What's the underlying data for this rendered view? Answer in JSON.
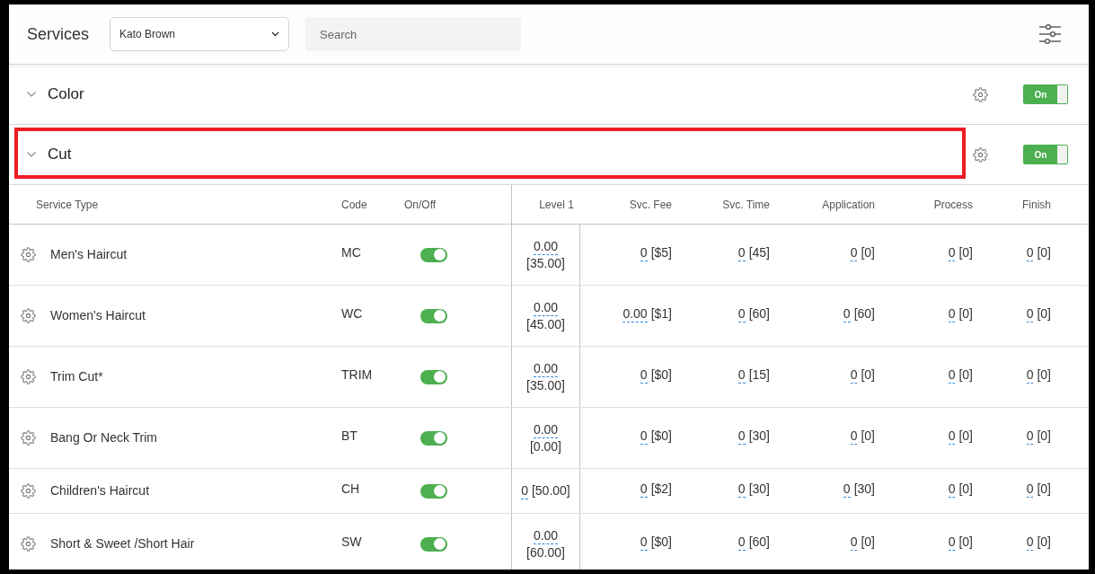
{
  "header": {
    "title": "Services",
    "staff_select": {
      "value": "Kato Brown"
    },
    "search": {
      "placeholder": "Search"
    }
  },
  "categories": [
    {
      "name": "Color",
      "highlighted": false,
      "toggle": {
        "label": "On",
        "on": true
      }
    },
    {
      "name": "Cut",
      "highlighted": true,
      "toggle": {
        "label": "On",
        "on": true
      },
      "table": {
        "columns": [
          {
            "label": "Service Type",
            "kind": "name"
          },
          {
            "label": "Code",
            "kind": "code"
          },
          {
            "label": "On/Off",
            "kind": "toggle"
          },
          {
            "label": "Level 1",
            "kind": "level"
          },
          {
            "label": "Svc. Fee",
            "kind": "amount"
          },
          {
            "label": "Svc. Time",
            "kind": "amount"
          },
          {
            "label": "Application",
            "kind": "amount"
          },
          {
            "label": "Process",
            "kind": "amount"
          },
          {
            "label": "Finish",
            "kind": "amount"
          }
        ],
        "rows": [
          {
            "cells": [
              {
                "text": "Men's Haircut"
              },
              {
                "text": "MC"
              },
              {
                "on": true
              },
              {
                "value": "0.00",
                "base": "[35.00]"
              },
              {
                "value": "0",
                "base": "[$5]"
              },
              {
                "value": "0",
                "base": "[45]"
              },
              {
                "value": "0",
                "base": "[0]"
              },
              {
                "value": "0",
                "base": "[0]"
              },
              {
                "value": "0",
                "base": "[0]"
              }
            ]
          },
          {
            "cells": [
              {
                "text": "Women's Haircut"
              },
              {
                "text": "WC"
              },
              {
                "on": true
              },
              {
                "value": "0.00",
                "base": "[45.00]"
              },
              {
                "value": "0.00",
                "base": "[$1]"
              },
              {
                "value": "0",
                "base": "[60]"
              },
              {
                "value": "0",
                "base": "[60]"
              },
              {
                "value": "0",
                "base": "[0]"
              },
              {
                "value": "0",
                "base": "[0]"
              }
            ]
          },
          {
            "cells": [
              {
                "text": "Trim Cut*"
              },
              {
                "text": "TRIM"
              },
              {
                "on": true
              },
              {
                "value": "0.00",
                "base": "[35.00]"
              },
              {
                "value": "0",
                "base": "[$0]"
              },
              {
                "value": "0",
                "base": "[15]"
              },
              {
                "value": "0",
                "base": "[0]"
              },
              {
                "value": "0",
                "base": "[0]"
              },
              {
                "value": "0",
                "base": "[0]"
              }
            ]
          },
          {
            "cells": [
              {
                "text": "Bang Or Neck Trim"
              },
              {
                "text": "BT"
              },
              {
                "on": true
              },
              {
                "value": "0.00",
                "base": "[0.00]"
              },
              {
                "value": "0",
                "base": "[$0]"
              },
              {
                "value": "0",
                "base": "[30]"
              },
              {
                "value": "0",
                "base": "[0]"
              },
              {
                "value": "0",
                "base": "[0]"
              },
              {
                "value": "0",
                "base": "[0]"
              }
            ]
          },
          {
            "cells": [
              {
                "text": "Children's Haircut"
              },
              {
                "text": "CH"
              },
              {
                "on": true
              },
              {
                "value": "0",
                "base": "[50.00]"
              },
              {
                "value": "0",
                "base": "[$2]"
              },
              {
                "value": "0",
                "base": "[30]"
              },
              {
                "value": "0",
                "base": "[30]"
              },
              {
                "value": "0",
                "base": "[0]"
              },
              {
                "value": "0",
                "base": "[0]"
              }
            ]
          },
          {
            "cells": [
              {
                "text": "Short & Sweet /Short Hair"
              },
              {
                "text": "SW"
              },
              {
                "on": true
              },
              {
                "value": "0.00",
                "base": "[60.00]"
              },
              {
                "value": "0",
                "base": "[$0]"
              },
              {
                "value": "0",
                "base": "[60]"
              },
              {
                "value": "0",
                "base": "[0]"
              },
              {
                "value": "0",
                "base": "[0]"
              },
              {
                "value": "0",
                "base": "[0]"
              }
            ]
          }
        ]
      }
    }
  ]
}
